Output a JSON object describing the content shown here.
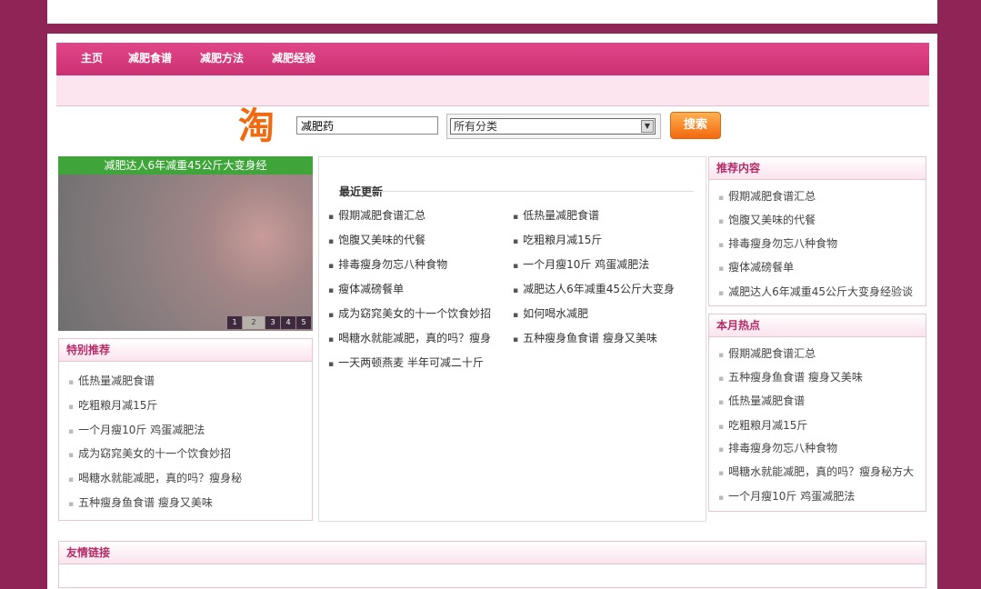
{
  "nav": {
    "items": [
      "主页",
      "减肥食谱",
      "减肥方法",
      "减肥经验"
    ]
  },
  "search": {
    "logo": "淘",
    "input_value": "减肥药",
    "category_selected": "所有分类",
    "button_label": "搜索"
  },
  "slideshow": {
    "caption": "减肥达人6年减重45公斤大变身经",
    "pages": [
      "1",
      "2",
      "3",
      "4",
      "5"
    ],
    "active_page": "2"
  },
  "special": {
    "title": "特别推荐",
    "items": [
      "低热量减肥食谱",
      "吃粗粮月减15斤",
      "一个月瘦10斤 鸡蛋减肥法",
      "成为窈窕美女的十一个饮食妙招",
      "喝糖水就能减肥，真的吗？瘦身秘",
      "五种瘦身鱼食谱 瘦身又美味"
    ]
  },
  "recent": {
    "title": "最近更新",
    "left": [
      "假期减肥食谱汇总",
      "饱腹又美味的代餐",
      "排毒瘦身勿忘八种食物",
      "瘦体减磅餐单",
      "成为窈窕美女的十一个饮食妙招",
      "喝糖水就能减肥，真的吗？瘦身",
      "一天两顿燕麦 半年可减二十斤"
    ],
    "right": [
      "低热量减肥食谱",
      "吃粗粮月减15斤",
      "一个月瘦10斤 鸡蛋减肥法",
      "减肥达人6年减重45公斤大变身",
      "如何喝水减肥",
      "五种瘦身鱼食谱 瘦身又美味"
    ]
  },
  "recommend": {
    "title": "推荐内容",
    "items": [
      "假期减肥食谱汇总",
      "饱腹又美味的代餐",
      "排毒瘦身勿忘八种食物",
      "瘦体减磅餐单",
      "减肥达人6年减重45公斤大变身经验谈"
    ]
  },
  "hot": {
    "title": "本月热点",
    "items": [
      "假期减肥食谱汇总",
      "五种瘦身鱼食谱 瘦身又美味",
      "低热量减肥食谱",
      "吃粗粮月减15斤",
      "排毒瘦身勿忘八种食物",
      "喝糖水就能减肥，真的吗？瘦身秘方大",
      "一个月瘦10斤 鸡蛋减肥法"
    ]
  },
  "links": {
    "title": "友情链接"
  },
  "colors": {
    "background": "#8e2556",
    "nav": "#d63a7c",
    "accent": "#b52a67",
    "search_button": "#f2680e",
    "slide_caption": "#3fa53a"
  }
}
